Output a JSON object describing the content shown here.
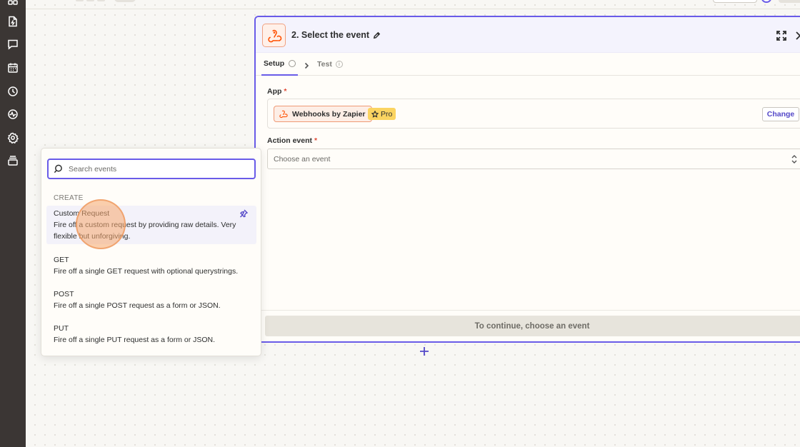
{
  "panel": {
    "title": "2. Select the event",
    "tabs": {
      "setup": "Setup",
      "test": "Test"
    },
    "app_label": "App",
    "required_mark": "*",
    "app_name": "Webhooks by Zapier",
    "pro_badge": "Pro",
    "change_label": "Change",
    "action_event_label": "Action event",
    "action_event_placeholder": "Choose an event",
    "continue_label": "To continue, choose an event"
  },
  "dropdown": {
    "search_placeholder": "Search events",
    "section": "CREATE",
    "events": [
      {
        "title": "Custom Request",
        "desc": "Fire off a custom request by providing raw details. Very flexible but unforgiving."
      },
      {
        "title": "GET",
        "desc": "Fire off a single GET request with optional querystrings."
      },
      {
        "title": "POST",
        "desc": "Fire off a single POST request as a form or JSON."
      },
      {
        "title": "PUT",
        "desc": "Fire off a single PUT request as a form or JSON."
      }
    ]
  },
  "colors": {
    "accent": "#695be8",
    "webhook_orange": "#ff4f00",
    "rail": "#3b3634",
    "pro_yellow": "#fbd461"
  },
  "icons": {
    "rail": [
      "apps-icon",
      "zap-file-icon",
      "chat-icon",
      "calendar-icon",
      "history-icon",
      "activity-icon",
      "settings-icon",
      "layers-icon"
    ],
    "app": "webhook-icon",
    "search": "search-icon",
    "pin": "pin-icon"
  }
}
